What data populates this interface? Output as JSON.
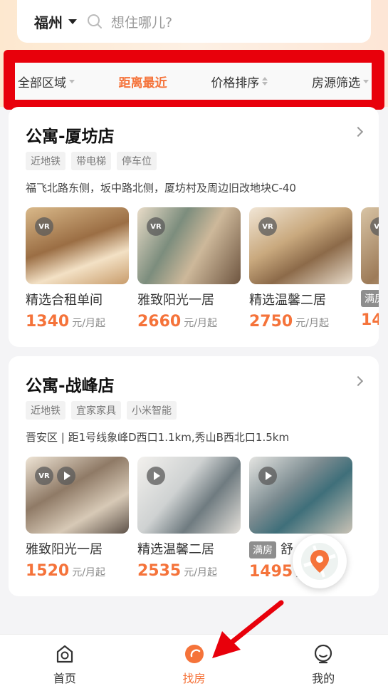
{
  "search": {
    "city": "福州",
    "placeholder": "想住哪儿?"
  },
  "filters": [
    {
      "label": "全部区域",
      "active": false,
      "icon": "caret-down-icon"
    },
    {
      "label": "距离最近",
      "active": true,
      "icon": ""
    },
    {
      "label": "价格排序",
      "active": false,
      "icon": "sort-icon"
    },
    {
      "label": "房源筛选",
      "active": false,
      "icon": "caret-down-icon"
    }
  ],
  "stores": [
    {
      "name": "公寓-厦坊店",
      "tags": [
        "近地铁",
        "带电梯",
        "停车位"
      ],
      "address": "福飞北路东侧，坂中路北侧，厦坊村及周边旧改地块C-40",
      "rooms": [
        {
          "name": "精选合租单间",
          "price": "1340",
          "unit": "元/月起",
          "vr": true,
          "video": false,
          "full": false
        },
        {
          "name": "雅致阳光一居",
          "price": "2660",
          "unit": "元/月起",
          "vr": true,
          "video": false,
          "full": false
        },
        {
          "name": "精选温馨二居",
          "price": "2750",
          "unit": "元/月起",
          "vr": true,
          "video": false,
          "full": false
        },
        {
          "name": "",
          "price": "14",
          "unit": "",
          "vr": true,
          "video": false,
          "full": true,
          "full_label": "满房"
        }
      ]
    },
    {
      "name": "公寓-战峰店",
      "tags": [
        "近地铁",
        "宜家家具",
        "小米智能"
      ],
      "address": "晋安区 | 距1号线象峰D西口1.1km,秀山B西北口1.5km",
      "rooms": [
        {
          "name": "雅致阳光一居",
          "price": "1520",
          "unit": "元/月起",
          "vr": true,
          "video": true,
          "full": false
        },
        {
          "name": "精选温馨二居",
          "price": "2535",
          "unit": "元/月起",
          "vr": false,
          "video": true,
          "full": false
        },
        {
          "name": "舒",
          "price": "1495",
          "unit": "元",
          "vr": false,
          "video": true,
          "full": true,
          "full_label": "满房"
        }
      ]
    }
  ],
  "badges": {
    "vr": "VR"
  },
  "nav": [
    {
      "label": "首页",
      "icon": "home-icon",
      "active": false
    },
    {
      "label": "找房",
      "icon": "find-room-icon",
      "active": true
    },
    {
      "label": "我的",
      "icon": "profile-icon",
      "active": false
    }
  ],
  "colors": {
    "accent": "#f5733a",
    "highlight": "#e8000b"
  }
}
